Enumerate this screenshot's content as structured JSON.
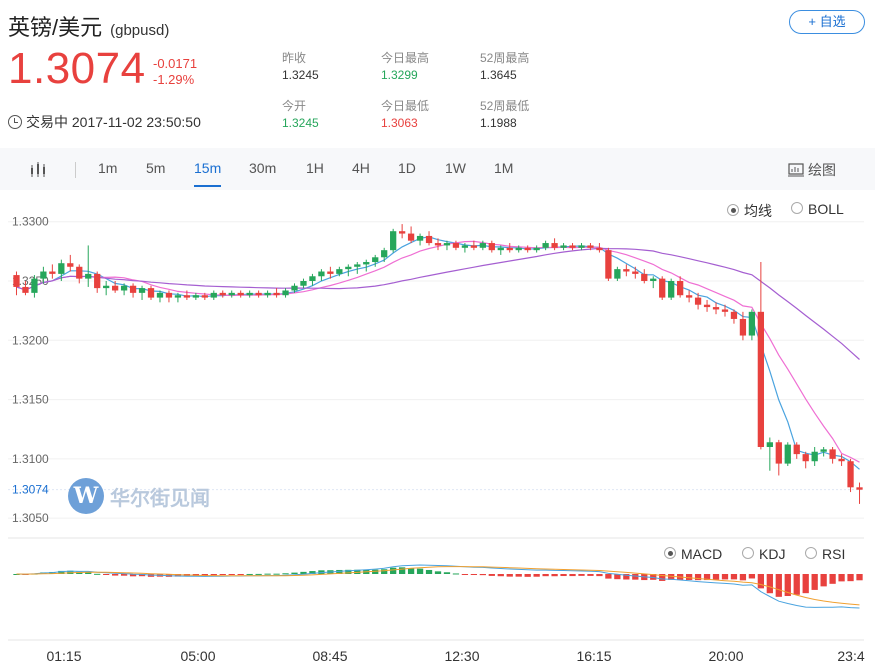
{
  "header": {
    "title": "英镑/美元",
    "code": "(gbpusd)",
    "add_button": "+ 自选"
  },
  "quote": {
    "price": "1.3074",
    "change": "-0.0171",
    "change_pct": "-1.29%",
    "status": "交易中 2017-11-02 23:50:50",
    "prev_close_label": "昨收",
    "prev_close": "1.3245",
    "high_label": "今日最高",
    "high": "1.3299",
    "week52_high_label": "52周最高",
    "week52_high": "1.3645",
    "open_label": "今开",
    "open": "1.3245",
    "low_label": "今日最低",
    "low": "1.3063",
    "week52_low_label": "52周最低",
    "week52_low": "1.1988"
  },
  "toolbar": {
    "intervals": [
      "1m",
      "5m",
      "15m",
      "30m",
      "1H",
      "4H",
      "1D",
      "1W",
      "1M"
    ],
    "active": "15m",
    "draw_label": "绘图"
  },
  "overlays": {
    "ma_label": "均线",
    "boll_label": "BOLL",
    "selected": "均线"
  },
  "indicators": {
    "macd_label": "MACD",
    "kdj_label": "KDJ",
    "rsi_label": "RSI",
    "selected": "MACD"
  },
  "watermark": {
    "text": "华尔街见闻"
  },
  "colors": {
    "up": "#26a65b",
    "down": "#e8413e",
    "accent": "#1a6fd1"
  },
  "chart_data": {
    "type": "candlestick",
    "y_ticks": [
      "1.3300",
      "1.3250",
      "1.3200",
      "1.3150",
      "1.3100",
      "1.3050"
    ],
    "current_label": "1.3074",
    "ylim": [
      1.304,
      1.332
    ],
    "x_ticks": [
      "01:15",
      "05:00",
      "08:45",
      "12:30",
      "16:15",
      "20:00",
      "23:4"
    ],
    "candles": [
      [
        1.3255,
        1.3258,
        1.3238,
        1.3245
      ],
      [
        1.3245,
        1.325,
        1.3238,
        1.324
      ],
      [
        1.324,
        1.3255,
        1.3236,
        1.3252
      ],
      [
        1.3252,
        1.3262,
        1.3248,
        1.3258
      ],
      [
        1.3258,
        1.3264,
        1.3252,
        1.3256
      ],
      [
        1.3256,
        1.3268,
        1.325,
        1.3265
      ],
      [
        1.3265,
        1.3272,
        1.3258,
        1.3262
      ],
      [
        1.3262,
        1.3264,
        1.3248,
        1.3252
      ],
      [
        1.3252,
        1.328,
        1.3245,
        1.3256
      ],
      [
        1.3256,
        1.3258,
        1.324,
        1.3244
      ],
      [
        1.3244,
        1.325,
        1.3238,
        1.3246
      ],
      [
        1.3246,
        1.325,
        1.324,
        1.3242
      ],
      [
        1.3242,
        1.3248,
        1.3238,
        1.3246
      ],
      [
        1.3246,
        1.3248,
        1.3236,
        1.324
      ],
      [
        1.324,
        1.3246,
        1.3234,
        1.3244
      ],
      [
        1.3244,
        1.3246,
        1.3234,
        1.3236
      ],
      [
        1.3236,
        1.3242,
        1.3232,
        1.324
      ],
      [
        1.324,
        1.3242,
        1.3232,
        1.3236
      ],
      [
        1.3236,
        1.324,
        1.3232,
        1.3238
      ],
      [
        1.3238,
        1.3242,
        1.3234,
        1.3236
      ],
      [
        1.3236,
        1.324,
        1.3234,
        1.3238
      ],
      [
        1.3238,
        1.324,
        1.3234,
        1.3236
      ],
      [
        1.3236,
        1.3242,
        1.3234,
        1.324
      ],
      [
        1.324,
        1.3242,
        1.3236,
        1.3238
      ],
      [
        1.3238,
        1.3242,
        1.3236,
        1.324
      ],
      [
        1.324,
        1.3242,
        1.3236,
        1.3238
      ],
      [
        1.3238,
        1.3242,
        1.3236,
        1.324
      ],
      [
        1.324,
        1.3242,
        1.3236,
        1.3238
      ],
      [
        1.3238,
        1.3242,
        1.3236,
        1.324
      ],
      [
        1.324,
        1.3244,
        1.3236,
        1.3238
      ],
      [
        1.3238,
        1.3244,
        1.3236,
        1.3242
      ],
      [
        1.3242,
        1.3248,
        1.324,
        1.3246
      ],
      [
        1.3246,
        1.3252,
        1.3244,
        1.325
      ],
      [
        1.325,
        1.3256,
        1.3246,
        1.3254
      ],
      [
        1.3254,
        1.326,
        1.325,
        1.3258
      ],
      [
        1.3258,
        1.3262,
        1.3252,
        1.3256
      ],
      [
        1.3256,
        1.3262,
        1.3254,
        1.326
      ],
      [
        1.326,
        1.3264,
        1.3254,
        1.3262
      ],
      [
        1.3262,
        1.3266,
        1.3256,
        1.3264
      ],
      [
        1.3264,
        1.3268,
        1.3258,
        1.3266
      ],
      [
        1.3266,
        1.3272,
        1.3262,
        1.327
      ],
      [
        1.327,
        1.3278,
        1.3266,
        1.3276
      ],
      [
        1.3276,
        1.3294,
        1.3274,
        1.3292
      ],
      [
        1.3292,
        1.3298,
        1.3286,
        1.329
      ],
      [
        1.329,
        1.3296,
        1.3282,
        1.3284
      ],
      [
        1.3284,
        1.329,
        1.328,
        1.3288
      ],
      [
        1.3288,
        1.3292,
        1.328,
        1.3282
      ],
      [
        1.3282,
        1.3286,
        1.3276,
        1.328
      ],
      [
        1.328,
        1.3284,
        1.3276,
        1.3282
      ],
      [
        1.3282,
        1.3284,
        1.3276,
        1.3278
      ],
      [
        1.3278,
        1.3282,
        1.3274,
        1.328
      ],
      [
        1.328,
        1.3284,
        1.3276,
        1.3278
      ],
      [
        1.3278,
        1.3284,
        1.3276,
        1.3282
      ],
      [
        1.3282,
        1.3284,
        1.3274,
        1.3276
      ],
      [
        1.3276,
        1.328,
        1.3272,
        1.3278
      ],
      [
        1.3278,
        1.3282,
        1.3274,
        1.3276
      ],
      [
        1.3276,
        1.328,
        1.3274,
        1.3278
      ],
      [
        1.3278,
        1.328,
        1.3274,
        1.3276
      ],
      [
        1.3276,
        1.328,
        1.3274,
        1.3278
      ],
      [
        1.3278,
        1.3284,
        1.3276,
        1.3282
      ],
      [
        1.3282,
        1.3286,
        1.3276,
        1.3278
      ],
      [
        1.3278,
        1.3282,
        1.3276,
        1.328
      ],
      [
        1.328,
        1.3282,
        1.3276,
        1.3278
      ],
      [
        1.3278,
        1.3282,
        1.3276,
        1.328
      ],
      [
        1.328,
        1.3282,
        1.3276,
        1.3278
      ],
      [
        1.3278,
        1.3282,
        1.3274,
        1.3276
      ],
      [
        1.3276,
        1.3278,
        1.325,
        1.3252
      ],
      [
        1.3252,
        1.3262,
        1.325,
        1.326
      ],
      [
        1.326,
        1.3264,
        1.3254,
        1.3258
      ],
      [
        1.3258,
        1.3262,
        1.3252,
        1.3256
      ],
      [
        1.3256,
        1.326,
        1.3248,
        1.325
      ],
      [
        1.325,
        1.3254,
        1.3244,
        1.3252
      ],
      [
        1.3252,
        1.3254,
        1.3234,
        1.3236
      ],
      [
        1.3236,
        1.3252,
        1.3234,
        1.325
      ],
      [
        1.325,
        1.3254,
        1.3236,
        1.3238
      ],
      [
        1.3238,
        1.3242,
        1.3232,
        1.3236
      ],
      [
        1.3236,
        1.324,
        1.3226,
        1.323
      ],
      [
        1.323,
        1.3234,
        1.3224,
        1.3228
      ],
      [
        1.3228,
        1.3232,
        1.3222,
        1.3226
      ],
      [
        1.3226,
        1.323,
        1.322,
        1.3224
      ],
      [
        1.3224,
        1.3226,
        1.3214,
        1.3218
      ],
      [
        1.3218,
        1.3224,
        1.32,
        1.3204
      ],
      [
        1.3204,
        1.3226,
        1.32,
        1.3224
      ],
      [
        1.3224,
        1.3266,
        1.3108,
        1.311
      ],
      [
        1.311,
        1.3118,
        1.309,
        1.3114
      ],
      [
        1.3114,
        1.3116,
        1.3086,
        1.3096
      ],
      [
        1.3096,
        1.3114,
        1.3094,
        1.3112
      ],
      [
        1.3112,
        1.3114,
        1.31,
        1.3104
      ],
      [
        1.3104,
        1.3106,
        1.3092,
        1.3098
      ],
      [
        1.3098,
        1.311,
        1.3094,
        1.3106
      ],
      [
        1.3106,
        1.311,
        1.3102,
        1.3108
      ],
      [
        1.3108,
        1.311,
        1.3096,
        1.31
      ],
      [
        1.31,
        1.3104,
        1.3094,
        1.3098
      ],
      [
        1.3098,
        1.31,
        1.3072,
        1.3076
      ],
      [
        1.3076,
        1.308,
        1.3062,
        1.3074
      ]
    ]
  }
}
